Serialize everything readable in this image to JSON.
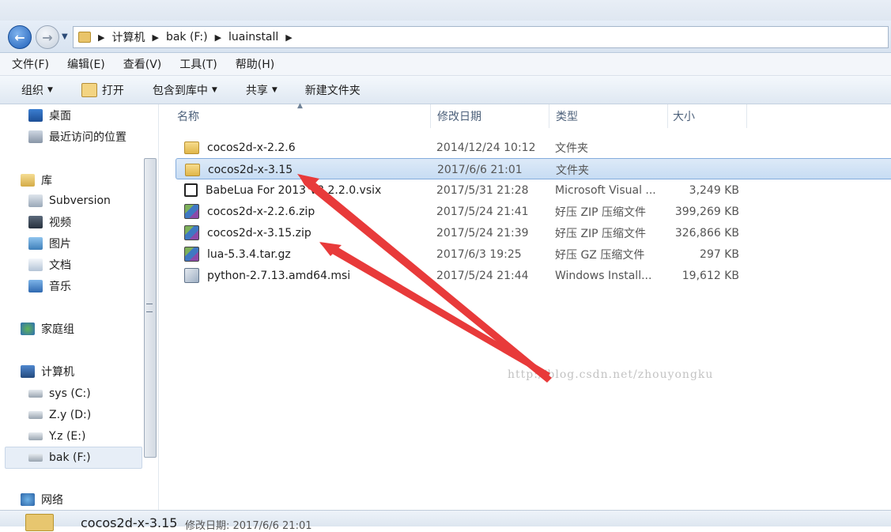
{
  "window": {
    "breadcrumb": [
      "计算机",
      "bak (F:)",
      "luainstall"
    ]
  },
  "menu": [
    "文件(F)",
    "编辑(E)",
    "查看(V)",
    "工具(T)",
    "帮助(H)"
  ],
  "toolbar": {
    "organize": "组织",
    "open": "打开",
    "include": "包含到库中",
    "share": "共享",
    "new_folder": "新建文件夹"
  },
  "nav": {
    "desktop": "桌面",
    "recent": "最近访问的位置",
    "libraries": "库",
    "subversion": "Subversion",
    "videos": "视频",
    "pictures": "图片",
    "documents": "文档",
    "music": "音乐",
    "homegroup": "家庭组",
    "computer": "计算机",
    "drive_c": "sys (C:)",
    "drive_d": "Z.y (D:)",
    "drive_e": "Y.z (E:)",
    "drive_f": "bak (F:)",
    "network": "网络"
  },
  "columns": {
    "name": "名称",
    "date": "修改日期",
    "type": "类型",
    "size": "大小"
  },
  "files": [
    {
      "name": "cocos2d-x-2.2.6",
      "date": "2014/12/24 10:12",
      "type": "文件夹",
      "size": "",
      "icon": "folder-icon"
    },
    {
      "name": "cocos2d-x-3.15",
      "date": "2017/6/6 21:01",
      "type": "文件夹",
      "size": "",
      "icon": "folder-icon"
    },
    {
      "name": "BabeLua For 2013 V3.2.2.0.vsix",
      "date": "2017/5/31 21:28",
      "type": "Microsoft Visual ...",
      "size": "3,249 KB",
      "icon": "vsix-icon"
    },
    {
      "name": "cocos2d-x-2.2.6.zip",
      "date": "2017/5/24 21:41",
      "type": "好压 ZIP 压缩文件",
      "size": "399,269 KB",
      "icon": "zip-icon"
    },
    {
      "name": "cocos2d-x-3.15.zip",
      "date": "2017/5/24 21:39",
      "type": "好压 ZIP 压缩文件",
      "size": "326,866 KB",
      "icon": "zip-icon"
    },
    {
      "name": "lua-5.3.4.tar.gz",
      "date": "2017/6/3 19:25",
      "type": "好压 GZ 压缩文件",
      "size": "297 KB",
      "icon": "zip-icon"
    },
    {
      "name": "python-2.7.13.amd64.msi",
      "date": "2017/5/24 21:44",
      "type": "Windows Install...",
      "size": "19,612 KB",
      "icon": "msi-icon"
    }
  ],
  "selected_index": 1,
  "watermark": "http://blog.csdn.net/zhouyongku",
  "status": {
    "name": "cocos2d-x-3.15",
    "meta": "修改日期: 2017/6/6 21:01"
  },
  "annotation_color": "#e83a3a"
}
